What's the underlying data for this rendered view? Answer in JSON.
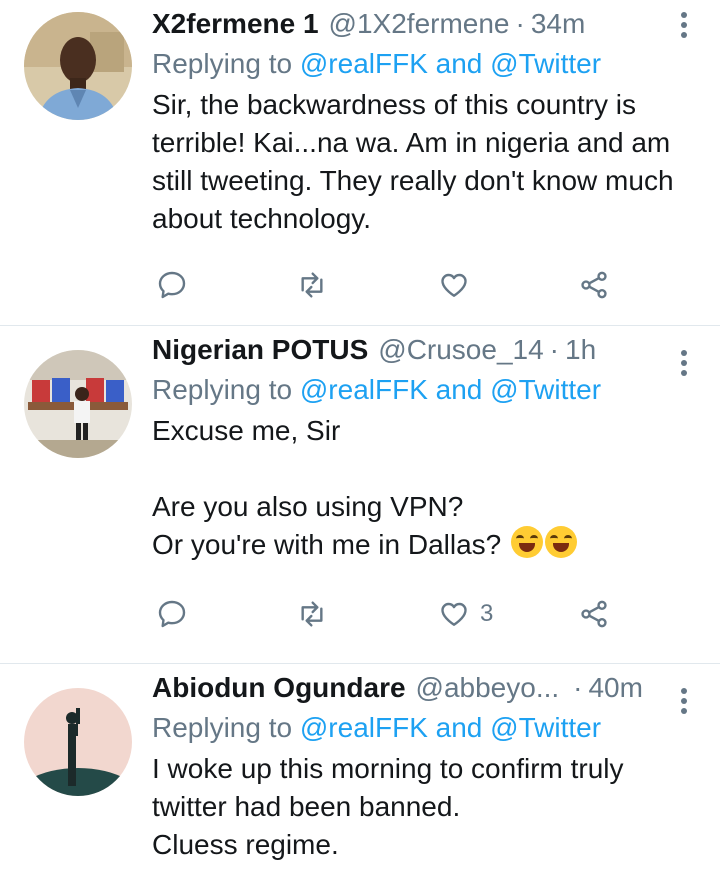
{
  "tweets": [
    {
      "name": "X2fermene 1",
      "handle": "@1X2fermene",
      "separator": "·",
      "time": "34m",
      "reply_prefix": "Replying to ",
      "reply_mentions": "@realFFK and @Twitter",
      "text": "Sir, the backwardness of this country is terrible! Kai...na wa. Am in nigeria and am still tweeting. They really don't know much about technology.",
      "like_count": ""
    },
    {
      "name": "Nigerian POTUS",
      "handle": "@Crusoe_14",
      "separator": "·",
      "time": "1h",
      "reply_prefix": "Replying to ",
      "reply_mentions": "@realFFK and @Twitter",
      "text": "Excuse me, Sir\n\nAre you also using VPN?\nOr you're with me in Dallas?",
      "emoji": "face-with-tears-of-joy x2",
      "like_count": "3"
    },
    {
      "name": "Abiodun Ogundare",
      "handle": "@abbeyo...",
      "separator": "·",
      "time": "40m",
      "reply_prefix": "Replying to ",
      "reply_mentions": "@realFFK and @Twitter",
      "text": "I woke up this morning to confirm truly twitter had been banned.\nCluess regime."
    }
  ],
  "colors": {
    "accent": "#1da1f2",
    "muted": "#657786",
    "text": "#14171a",
    "divider": "#e1e8ed"
  },
  "icons": [
    "reply-icon",
    "retweet-icon",
    "like-icon",
    "share-icon",
    "more-options-icon"
  ]
}
